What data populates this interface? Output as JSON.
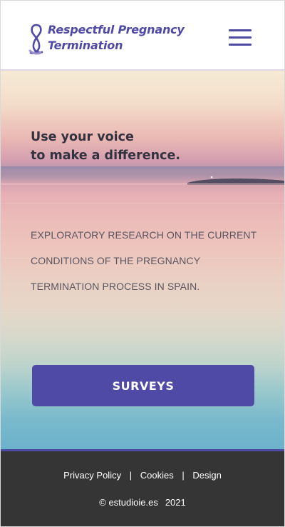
{
  "header": {
    "brand_line1": "Respectful Pregnancy",
    "brand_line2": "Termination",
    "logo_icon": "ribbon-icon",
    "menu_icon": "hamburger-menu-icon"
  },
  "hero": {
    "headline_line1": "Use your voice",
    "headline_line2": "to make a difference.",
    "research_line1": "EXPLORATORY RESEARCH ON THE CURRENT",
    "research_line2": "CONDITIONS OF THE PREGNANCY",
    "research_line3": "TERMINATION PROCESS IN SPAIN.",
    "button_label": "SURVEYS"
  },
  "footer": {
    "links": [
      "Privacy Policy",
      "Cookies",
      "Design"
    ],
    "separator": "|",
    "copyright_owner": "© estudioie.es",
    "copyright_year": "2021"
  },
  "colors": {
    "accent": "#4f4aa6",
    "footer_bg": "#353535",
    "text_dark": "#33333f"
  }
}
